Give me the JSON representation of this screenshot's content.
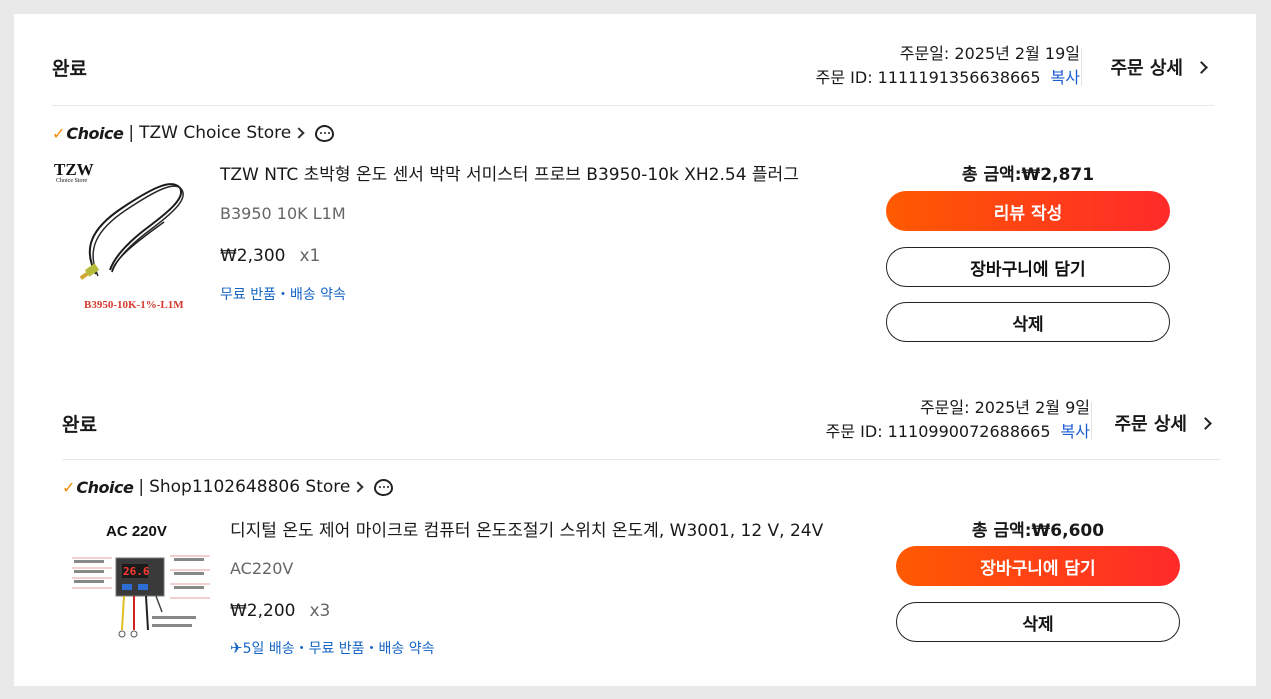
{
  "orders": [
    {
      "status": "완료",
      "order_date": "주문일: 2025년 2월 19일",
      "order_id": "주문 ID: 1111191356638665",
      "copy_label": "복사",
      "detail_label": "주문 상세",
      "store": {
        "choice_label": "Choice",
        "separator": "|",
        "name": "TZW Choice Store"
      },
      "item": {
        "brand_text": "TZW",
        "brand_sub": "Choice Store",
        "image_caption": "B3950-10K-1%-L1M",
        "title": "TZW NTC 초박형 온도 센서 박막 서미스터 프로브 B3950-10k XH2.54 플러그",
        "variant": "B3950 10K L1M",
        "price": "₩2,300",
        "qty": "x1",
        "tags": "무료 반품・배송 약속"
      },
      "total": "총 금액:₩2,871",
      "buttons": [
        "리뷰 작성",
        "장바구니에 담기",
        "삭제"
      ]
    },
    {
      "status": "완료",
      "order_date": "주문일: 2025년 2월 9일",
      "order_id": "주문 ID: 1110990072688665",
      "copy_label": "복사",
      "detail_label": "주문 상세",
      "store": {
        "choice_label": "Choice",
        "separator": "",
        "name": "Shop1102648806 Store"
      },
      "item": {
        "image_heading": "AC 220V",
        "display_value": "26.6",
        "title": "디지털 온도 제어 마이크로 컴퓨터 온도조절기 스위치 온도계, W3001, 12 V, 24V",
        "variant": "AC220V",
        "price": "₩2,200",
        "qty": "x3",
        "tags": "5일 배송・무료 반품・배송 약속"
      },
      "total": "총 금액:₩6,600",
      "buttons": [
        "장바구니에 담기",
        "삭제"
      ]
    }
  ],
  "colors": {
    "accent_gradient_start": "#ff5a00",
    "accent_gradient_end": "#ff2a2a",
    "link": "#1a5bd6",
    "tag": "#1664c4",
    "choice_check": "#f58a00"
  },
  "icons": {
    "chat": "chat-bubble-icon",
    "chevron": "chevron-right-icon",
    "plane": "airplane-icon"
  }
}
